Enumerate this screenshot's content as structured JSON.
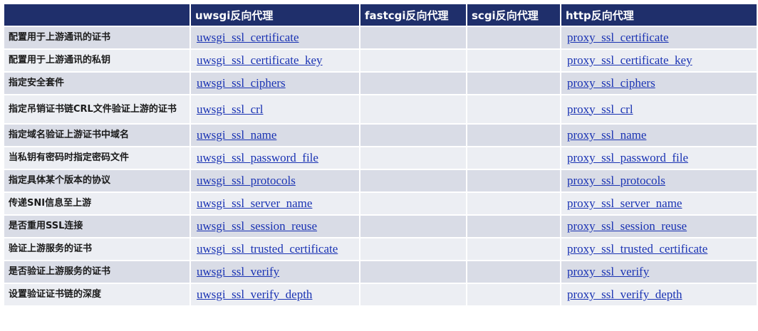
{
  "header": {
    "col0": "",
    "uwsgi": "uwsgi反向代理",
    "fastcgi": "fastcgi反向代理",
    "scgi": "scgi反向代理",
    "http": "http反向代理"
  },
  "rows": [
    {
      "label": "配置用于上游通讯的证书",
      "uwsgi": "uwsgi_ssl_certificate",
      "fastcgi": "",
      "scgi": "",
      "http": "proxy_ssl_certificate"
    },
    {
      "label": "配置用于上游通讯的私钥",
      "uwsgi": "uwsgi_ssl_certificate_key",
      "fastcgi": "",
      "scgi": "",
      "http": "proxy_ssl_certificate_key"
    },
    {
      "label": "指定安全套件",
      "uwsgi": "uwsgi_ssl_ciphers",
      "fastcgi": "",
      "scgi": "",
      "http": "proxy_ssl_ciphers"
    },
    {
      "label": "指定吊销证书链CRL文件验证上游的证书",
      "uwsgi": "uwsgi_ssl_crl",
      "fastcgi": "",
      "scgi": "",
      "http": "proxy_ssl_crl"
    },
    {
      "label": "指定域名验证上游证书中域名",
      "uwsgi": "uwsgi_ssl_name",
      "fastcgi": "",
      "scgi": "",
      "http": "proxy_ssl_name"
    },
    {
      "label": "当私钥有密码时指定密码文件",
      "uwsgi": "uwsgi_ssl_password_file",
      "fastcgi": "",
      "scgi": "",
      "http": "proxy_ssl_password_file"
    },
    {
      "label": "指定具体某个版本的协议",
      "uwsgi": "uwsgi_ssl_protocols",
      "fastcgi": "",
      "scgi": "",
      "http": "proxy_ssl_protocols"
    },
    {
      "label": "传递SNI信息至上游",
      "uwsgi": "uwsgi_ssl_server_name",
      "fastcgi": "",
      "scgi": "",
      "http": "proxy_ssl_server_name"
    },
    {
      "label": "是否重用SSL连接",
      "uwsgi": "uwsgi_ssl_session_reuse",
      "fastcgi": "",
      "scgi": "",
      "http": "proxy_ssl_session_reuse"
    },
    {
      "label": "验证上游服务的证书",
      "uwsgi": "uwsgi_ssl_trusted_certificate",
      "fastcgi": "",
      "scgi": "",
      "http": "proxy_ssl_trusted_certificate"
    },
    {
      "label": "是否验证上游服务的证书",
      "uwsgi": "uwsgi_ssl_verify",
      "fastcgi": "",
      "scgi": "",
      "http": "proxy_ssl_verify"
    },
    {
      "label": "设置验证证书链的深度",
      "uwsgi": "uwsgi_ssl_verify_depth",
      "fastcgi": "",
      "scgi": "",
      "http": "proxy_ssl_verify_depth"
    }
  ]
}
